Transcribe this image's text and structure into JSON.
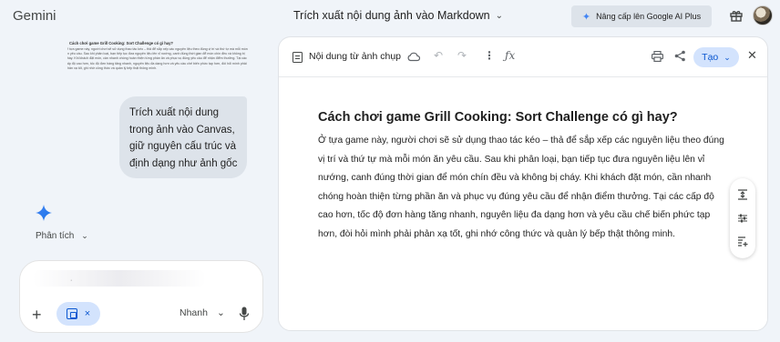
{
  "app": {
    "brand": "Gemini",
    "conversation_title": "Trích xuất nội dung ảnh vào Markdown",
    "upgrade_label": "Nâng cấp lên Google AI Plus"
  },
  "chat": {
    "thumbnail": {
      "title": "Cách chơi game Grill Cooking: Sort Challenge có gì hay?",
      "body": "Ở tựa game này, người chơi sẽ sử dụng thao tác kéo – thả để sắp xếp các nguyên liệu theo đúng vị trí và thứ tự mà mỗi món ăn yêu cầu. Sau khi phân loại, bạn tiếp tục đưa nguyên liệu lên vỉ nướng, canh đúng thời gian để món chín đều và không bị cháy. Khi khách đặt món, cần nhanh chóng hoàn thiện từng phần ăn và phục vụ đúng yêu cầu để nhận điểm thưởng. Tại các cấp độ cao hơn, tốc độ đơn hàng tăng nhanh, nguyên liệu đa dạng hơn và yêu cầu chế biến phức tạp hơn, đòi hỏi mình phải phản xạ tốt, ghi nhớ công thức và quản lý bếp thật thông minh."
    },
    "user_message": "Trích xuất nội dung trong ảnh vào Canvas, giữ nguyên cấu trúc và định dạng như ảnh gốc",
    "analysis_label": "Phân tích",
    "input": {
      "ghost_text": "·",
      "chip_close": "×",
      "model_label": "Nhanh"
    }
  },
  "canvas": {
    "title": "Nội dung từ ảnh chụp",
    "create_label": "Tạo",
    "heading": "Cách chơi game Grill Cooking: Sort Challenge có gì hay?",
    "paragraph": "Ở tựa game này, người chơi sẽ sử dụng thao tác kéo – thả để sắp xếp các nguyên liệu theo đúng vị trí và thứ tự mà mỗi món ăn yêu cầu. Sau khi phân loại, bạn tiếp tục đưa nguyên liệu lên vỉ nướng, canh đúng thời gian để món chín đều và không bị cháy. Khi khách đặt món, cần nhanh chóng hoàn thiện từng phần ăn và phục vụ đúng yêu cầu để nhận điểm thưởng. Tại các cấp độ cao hơn, tốc độ đơn hàng tăng nhanh, nguyên liệu đa dạng hơn và yêu cầu chế biến phức tạp hơn, đòi hỏi mình phải phản xạ tốt, ghi nhớ công thức và quản lý bếp thật thông minh."
  },
  "colors": {
    "accent": "#0b57d0",
    "chip_bg": "#d3e3fd",
    "page_bg": "#f0f4f9",
    "bubble_bg": "#dde3ea"
  },
  "icons": {
    "topbar": [
      "sparkle-icon",
      "gift-icon",
      "avatar"
    ],
    "canvas_toolbar": [
      "document-icon",
      "cloud-icon",
      "undo-icon",
      "redo-icon",
      "more-vert-icon",
      "function-icon",
      "print-icon",
      "share-icon",
      "chevron-down-icon",
      "close-icon"
    ],
    "side_rail": [
      "align-top-icon",
      "tune-icon",
      "add-comment-icon"
    ]
  }
}
